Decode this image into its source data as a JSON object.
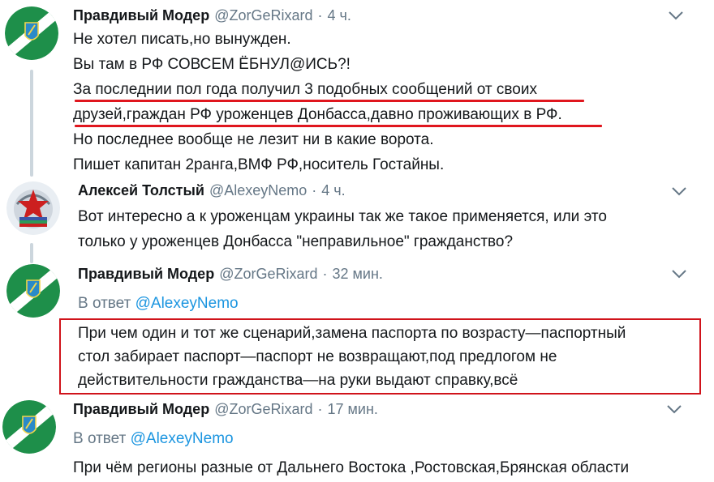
{
  "tweets": [
    {
      "name": "Правдивый Модер",
      "handle": "@ZorGeRixard",
      "dot": "·",
      "time": "4 ч.",
      "lines": [
        "Не хотел писать,но вынужден.",
        "Вы там в РФ СОВСЕМ ЁБНУЛ@ИСЬ?!",
        "За последнии пол года получил 3 подобных сообщений от своих",
        "друзей,граждан РФ уроженцев Донбасса,давно проживающих в РФ.",
        "Но последнее вообще не лезит ни в какие ворота.",
        "Пишет капитан 2ранга,ВМФ РФ,носитель Гостайны."
      ]
    },
    {
      "name": "Алексей Толстый",
      "handle": "@AlexeyNemo",
      "dot": "·",
      "time": "4 ч.",
      "lines": [
        "Вот интересно а к уроженцам украины так же такое применяется, или это",
        "только у уроженцев Донбасса \"неправильное\" гражданство?"
      ]
    },
    {
      "name": "Правдивый Модер",
      "handle": "@ZorGeRixard",
      "dot": "·",
      "time": "32 мин.",
      "reply_prefix": "В ответ",
      "reply_mention": "@AlexeyNemo",
      "lines": [
        "При чем один и тот же сценарий,замена паспорта по возрасту—паспортный",
        "стол забирает паспорт—паспорт не возвращают,под предлогом не",
        "действительности гражданства—на руки выдают справку,всё"
      ]
    },
    {
      "name": "Правдивый Модер",
      "handle": "@ZorGeRixard",
      "dot": "·",
      "time": "17 мин.",
      "reply_prefix": "В ответ",
      "reply_mention": "@AlexeyNemo",
      "lines": [
        "При чём регионы разные от Дальнего Востока ,Ростовская,Брянская области"
      ]
    }
  ],
  "colors": {
    "annotation_red": "#d0131b",
    "link_blue": "#1b95e0",
    "secondary_gray": "#657786",
    "avatar_green": "#1e8f4a"
  },
  "icons": {
    "avatar_moderator": "green-emblem-avatar",
    "avatar_alexey": "star-emblem-avatar",
    "menu": "chevron-down-icon"
  }
}
